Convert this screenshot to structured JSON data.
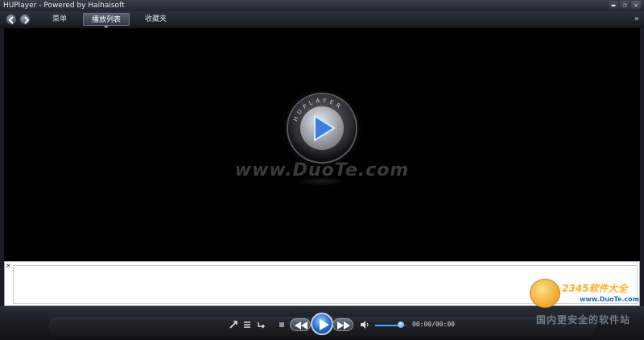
{
  "window": {
    "title": "HUPlayer - Powered by Haihaisoft",
    "min_glyph": "▬",
    "max_glyph": "❐",
    "close_glyph": "✕"
  },
  "nav": {
    "back_icon": "back-arrow-icon",
    "forward_icon": "forward-arrow-icon",
    "tabs": [
      {
        "label": "菜单"
      },
      {
        "label": "播放列表"
      },
      {
        "label": "收藏夹"
      }
    ],
    "more_glyph": "»"
  },
  "video": {
    "logo_letters": "HUPLAYER",
    "watermark": "www.DuoTe.com"
  },
  "playlist_panel": {
    "close_glyph": "×"
  },
  "controls": {
    "time": "00:00/00:00",
    "volume_level": 0.85,
    "accent_color": "#2769c9"
  },
  "corner_watermark": {
    "brand": "2345软件大全",
    "url": "www.DuoTe.com",
    "slogan": "国内更安全的软件站"
  }
}
